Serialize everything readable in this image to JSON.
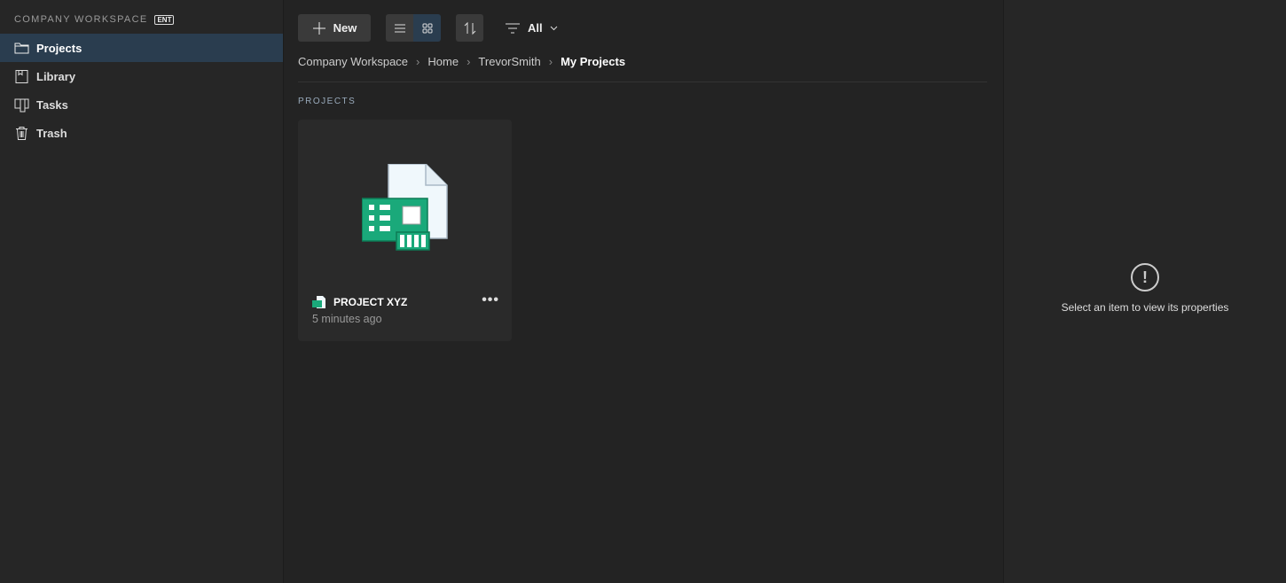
{
  "sidebar": {
    "workspace": "COMPANY WORKSPACE",
    "badge": "ENT",
    "items": [
      {
        "label": "Projects",
        "icon": "folder-icon"
      },
      {
        "label": "Library",
        "icon": "book-icon"
      },
      {
        "label": "Tasks",
        "icon": "board-icon"
      },
      {
        "label": "Trash",
        "icon": "trash-icon"
      }
    ]
  },
  "toolbar": {
    "new_label": "New",
    "filter_label": "All"
  },
  "breadcrumb": [
    "Company Workspace",
    "Home",
    "TrevorSmith",
    "My Projects"
  ],
  "section_label": "PROJECTS",
  "projects": [
    {
      "name": "PROJECT XYZ",
      "modified": "5 minutes ago"
    }
  ],
  "details": {
    "empty_message": "Select an item to view its properties"
  },
  "colors": {
    "accent": "#2a3d4f",
    "pcb": "#1aa97a"
  }
}
